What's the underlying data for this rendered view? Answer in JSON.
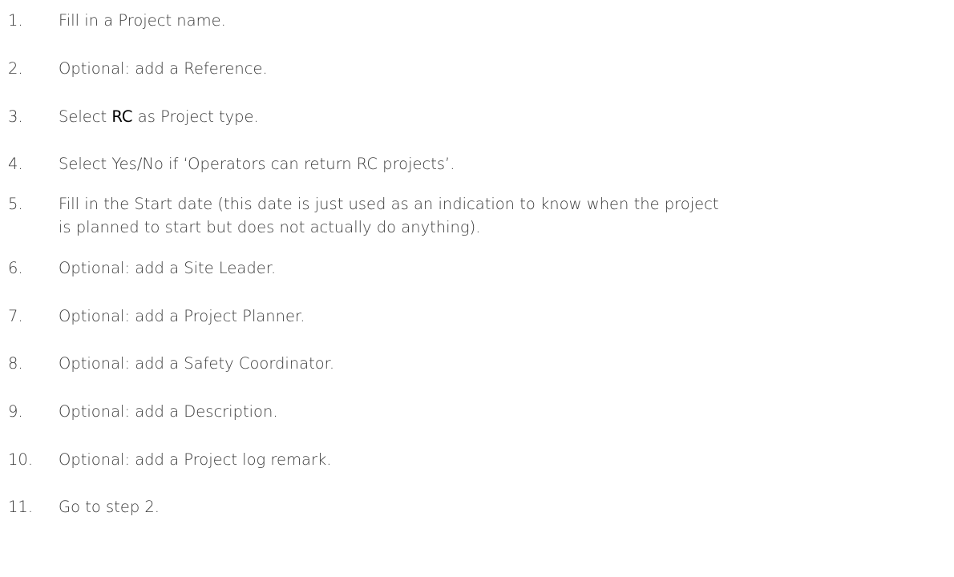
{
  "steps": [
    {
      "number": "1.",
      "lines": [
        "Fill in a Project name."
      ]
    },
    {
      "number": "2.",
      "lines": [
        "Optional: add a Reference."
      ]
    },
    {
      "number": "3.",
      "prefix": "Select ",
      "highlight": "RC",
      "suffix": " as Project type."
    },
    {
      "number": "4.",
      "lines": [
        "Select Yes/No if ‘Operators can return RC projects’."
      ]
    },
    {
      "number": "5.",
      "lines": [
        "Fill in the Start date (this date is just used as an indication to know when the project",
        "is planned to start but does not actually do anything)."
      ]
    },
    {
      "number": "6.",
      "lines": [
        "Optional: add a Site Leader."
      ]
    },
    {
      "number": "7.",
      "lines": [
        "Optional: add a Project Planner."
      ]
    },
    {
      "number": "8.",
      "lines": [
        "Optional: add a Safety Coordinator."
      ]
    },
    {
      "number": "9.",
      "lines": [
        "Optional: add a Description."
      ]
    },
    {
      "number": "10.",
      "lines": [
        "Optional: add a Project log remark."
      ]
    },
    {
      "number": "11.",
      "lines": [
        "Go to step 2."
      ]
    }
  ]
}
